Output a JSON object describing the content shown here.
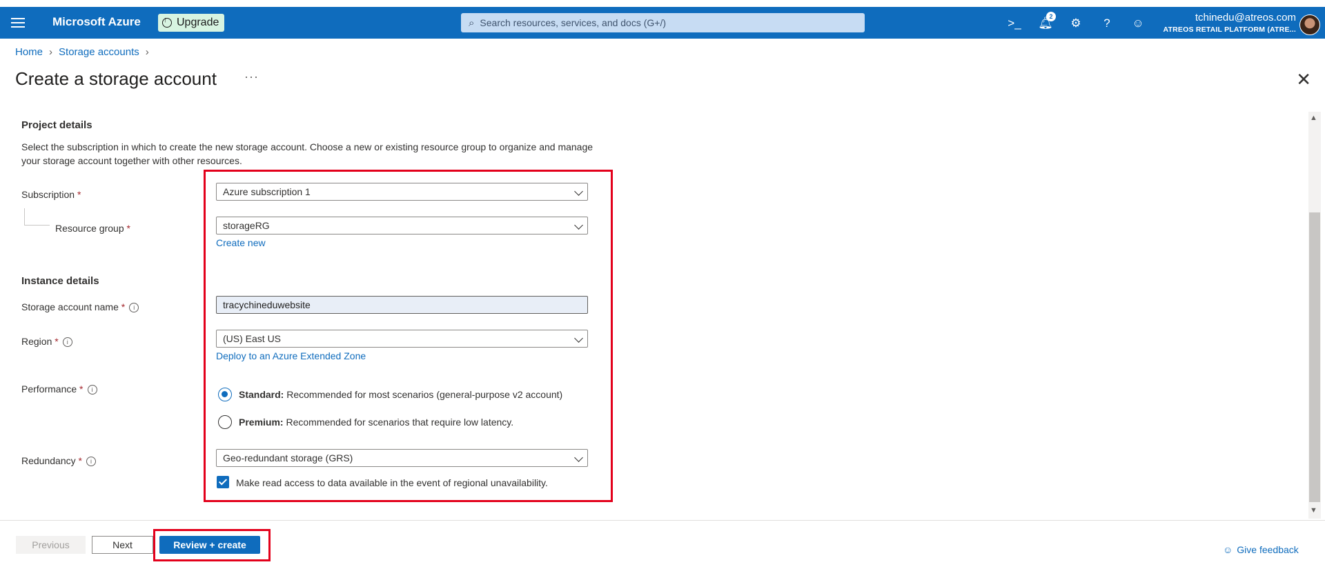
{
  "topbar": {
    "brand": "Microsoft Azure",
    "upgrade_label": "Upgrade",
    "search_placeholder": "Search resources, services, and docs (G+/)",
    "notifications_count": "2",
    "account_email": "tchinedu@atreos.com",
    "account_tenant": "ATREOS RETAIL PLATFORM (ATRE..."
  },
  "breadcrumb": {
    "home": "Home",
    "storage_accounts": "Storage accounts"
  },
  "page": {
    "title": "Create a storage account",
    "more": "···",
    "close": "✕"
  },
  "project_details": {
    "heading": "Project details",
    "description": "Select the subscription in which to create the new storage account. Choose a new or existing resource group to organize and manage your storage account together with other resources.",
    "subscription_label": "Subscription",
    "subscription_value": "Azure subscription 1",
    "resource_group_label": "Resource group",
    "resource_group_value": "storageRG",
    "create_new": "Create new"
  },
  "instance_details": {
    "heading": "Instance details",
    "name_label": "Storage account name",
    "name_value": "tracychineduwebsite",
    "region_label": "Region",
    "region_value": "(US) East US",
    "extended_zone_link": "Deploy to an Azure Extended Zone",
    "performance_label": "Performance",
    "standard_title": "Standard:",
    "standard_desc": "Recommended for most scenarios (general-purpose v2 account)",
    "premium_title": "Premium:",
    "premium_desc": "Recommended for scenarios that require low latency.",
    "redundancy_label": "Redundancy",
    "redundancy_value": "Geo-redundant storage (GRS)",
    "read_access_label": "Make read access to data available in the event of regional unavailability."
  },
  "required_mark": "*",
  "footer": {
    "previous": "Previous",
    "next": "Next",
    "review_create": "Review + create",
    "feedback": "Give feedback"
  },
  "colors": {
    "azure_blue": "#0f6cbd",
    "highlight_red": "#e3001b"
  }
}
